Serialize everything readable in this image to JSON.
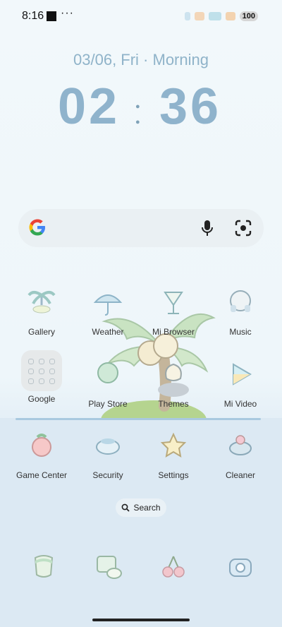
{
  "status_bar": {
    "time": "8:16",
    "overflow": "···",
    "battery": "100"
  },
  "clock": {
    "date": "03/06, Fri · Morning",
    "hours": "02",
    "minutes": "36"
  },
  "search_widget": {
    "logo": "google-g-icon",
    "mic_icon": "mic-icon",
    "lens_icon": "lens-icon"
  },
  "apps": [
    {
      "label": "Gallery",
      "icon": "gallery-icon"
    },
    {
      "label": "Weather",
      "icon": "weather-icon"
    },
    {
      "label": "Mi Browser",
      "icon": "browser-icon"
    },
    {
      "label": "Music",
      "icon": "music-icon"
    },
    {
      "label": "Google",
      "icon": "google-folder-icon"
    },
    {
      "label": "Play Store",
      "icon": "play-store-icon"
    },
    {
      "label": "Themes",
      "icon": "themes-icon"
    },
    {
      "label": "Mi Video",
      "icon": "video-icon"
    },
    {
      "label": "Game Center",
      "icon": "game-center-icon"
    },
    {
      "label": "Security",
      "icon": "security-icon"
    },
    {
      "label": "Settings",
      "icon": "settings-icon"
    },
    {
      "label": "Cleaner",
      "icon": "cleaner-icon"
    }
  ],
  "search_pill": {
    "label": "Search"
  },
  "dock": [
    {
      "icon": "phone-icon"
    },
    {
      "icon": "messages-icon"
    },
    {
      "icon": "chrome-icon"
    },
    {
      "icon": "camera-icon"
    }
  ],
  "colors": {
    "clock": "#8fb3cc",
    "water": "#dce9f3",
    "island_green": "#a9cf86"
  }
}
